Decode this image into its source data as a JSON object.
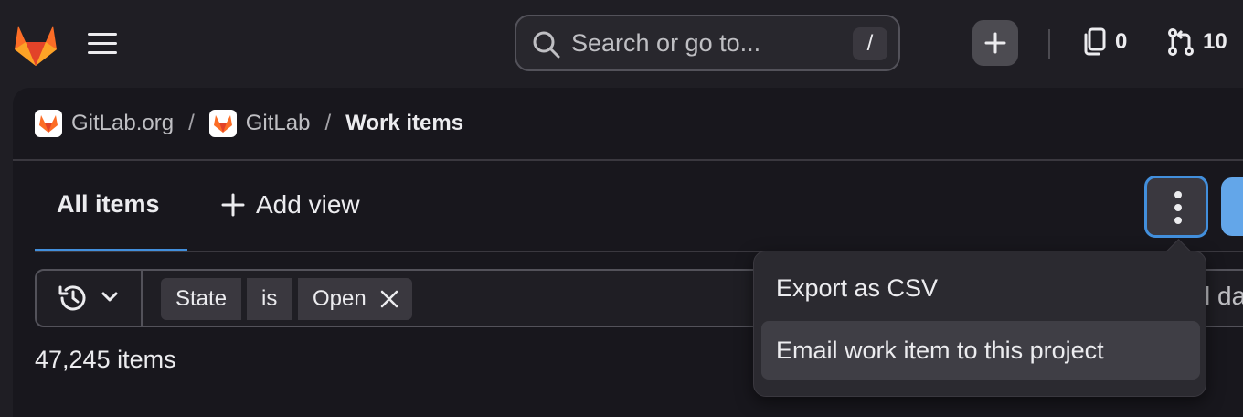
{
  "topbar": {
    "search_placeholder": "Search or go to...",
    "search_shortcut": "/",
    "issues_count": "0",
    "merge_requests_count": "10"
  },
  "breadcrumb": {
    "items": [
      "GitLab.org",
      "GitLab"
    ],
    "separator": "/",
    "current": "Work items"
  },
  "tabs": {
    "all_items": "All items",
    "add_view": "Add view"
  },
  "filter": {
    "tokens": [
      "State",
      "is",
      "Open"
    ],
    "partial_text_behind_menu": "l da"
  },
  "result_count": "47,245 items",
  "actions_menu": {
    "items": [
      "Export as CSV",
      "Email work item to this project"
    ]
  },
  "colors": {
    "accent": "#428fdc",
    "background": "#1f1e24",
    "panel": "#18171d",
    "logo_orange": "#e24329"
  }
}
